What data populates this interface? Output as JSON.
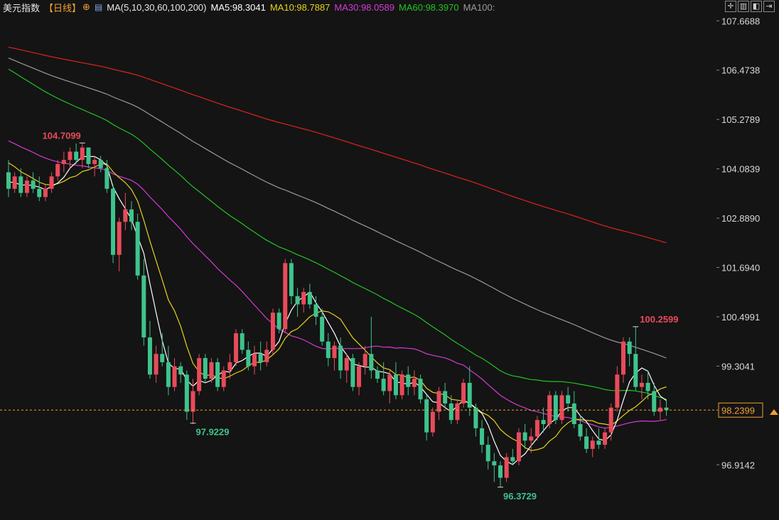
{
  "header": {
    "title": "美元指数",
    "period": "【日线】",
    "indicator": "MA(5,10,30,60,100,200)",
    "ma5": "MA5:98.3041",
    "ma10": "MA10:98.7887",
    "ma30": "MA30:98.0589",
    "ma60": "MA60:98.3970",
    "ma100": "MA100:"
  },
  "colors": {
    "up": "#e84b5a",
    "down": "#3fc38c",
    "ma5": "#ffffff",
    "ma10": "#e8d21a",
    "ma30": "#d63ad6",
    "ma60": "#22c322",
    "ma100": "#9a9a9a",
    "ma200": "#e02020",
    "price_line": "#f0a030"
  },
  "chart_data": {
    "type": "candlestick",
    "ylim": [
      96.3,
      107.76
    ],
    "yticks": [
      "107.6688",
      "106.4738",
      "105.2789",
      "104.0839",
      "102.8890",
      "101.6940",
      "100.4991",
      "99.3041",
      "96.9142"
    ],
    "current_price": "98.2399",
    "annotations": [
      {
        "label": "104.7099",
        "value": 104.7099,
        "color": "#e84b5a",
        "index": 12
      },
      {
        "label": "97.9229",
        "value": 97.9229,
        "color": "#3fc38c",
        "index": 30
      },
      {
        "label": "96.3729",
        "value": 96.3729,
        "color": "#3fc38c",
        "index": 80
      },
      {
        "label": "100.2599",
        "value": 100.2599,
        "color": "#e84b5a",
        "index": 102
      }
    ],
    "ohlc": [
      [
        104.0,
        104.3,
        103.4,
        103.6
      ],
      [
        103.6,
        104.0,
        103.5,
        103.9
      ],
      [
        103.9,
        104.1,
        103.4,
        103.5
      ],
      [
        103.5,
        103.9,
        103.4,
        103.8
      ],
      [
        103.8,
        104.0,
        103.5,
        103.6
      ],
      [
        103.6,
        103.9,
        103.3,
        103.4
      ],
      [
        103.4,
        103.7,
        103.3,
        103.6
      ],
      [
        103.6,
        104.0,
        103.5,
        103.9
      ],
      [
        103.9,
        104.3,
        103.8,
        104.2
      ],
      [
        104.2,
        104.5,
        104.0,
        104.3
      ],
      [
        104.3,
        104.6,
        104.1,
        104.5
      ],
      [
        104.5,
        104.7,
        104.2,
        104.3
      ],
      [
        104.3,
        104.7,
        104.1,
        104.6
      ],
      [
        104.6,
        104.6,
        104.1,
        104.2
      ],
      [
        104.2,
        104.4,
        103.9,
        104.3
      ],
      [
        104.3,
        104.4,
        104.0,
        104.1
      ],
      [
        104.1,
        104.3,
        103.5,
        103.6
      ],
      [
        103.6,
        103.7,
        101.8,
        102.0
      ],
      [
        102.0,
        102.9,
        101.6,
        102.8
      ],
      [
        102.8,
        103.5,
        102.6,
        103.1
      ],
      [
        103.1,
        103.3,
        102.6,
        102.8
      ],
      [
        102.8,
        103.0,
        101.4,
        101.5
      ],
      [
        101.5,
        101.9,
        99.8,
        100.0
      ],
      [
        100.0,
        100.4,
        99.0,
        99.1
      ],
      [
        99.1,
        99.8,
        98.9,
        99.6
      ],
      [
        99.6,
        100.1,
        99.3,
        99.4
      ],
      [
        99.4,
        99.8,
        98.6,
        98.8
      ],
      [
        98.8,
        99.5,
        98.7,
        99.3
      ],
      [
        99.3,
        99.4,
        98.9,
        99.1
      ],
      [
        99.1,
        99.2,
        98.0,
        98.2
      ],
      [
        98.2,
        99.0,
        97.9,
        98.7
      ],
      [
        98.7,
        99.6,
        98.6,
        99.5
      ],
      [
        99.5,
        99.6,
        98.9,
        99.0
      ],
      [
        99.0,
        99.5,
        98.9,
        99.4
      ],
      [
        99.4,
        99.5,
        98.7,
        98.8
      ],
      [
        98.8,
        99.3,
        98.7,
        99.2
      ],
      [
        99.2,
        99.6,
        99.0,
        99.4
      ],
      [
        99.4,
        100.2,
        99.3,
        100.1
      ],
      [
        100.1,
        100.2,
        99.6,
        99.7
      ],
      [
        99.7,
        99.9,
        99.2,
        99.3
      ],
      [
        99.3,
        99.8,
        99.1,
        99.6
      ],
      [
        99.6,
        99.9,
        99.2,
        99.4
      ],
      [
        99.4,
        99.9,
        99.3,
        99.7
      ],
      [
        99.7,
        100.7,
        99.6,
        100.6
      ],
      [
        100.6,
        100.7,
        100.1,
        100.2
      ],
      [
        100.2,
        101.9,
        100.1,
        101.8
      ],
      [
        101.8,
        101.9,
        100.8,
        101.0
      ],
      [
        101.0,
        101.2,
        100.5,
        100.8
      ],
      [
        100.8,
        101.2,
        100.6,
        101.1
      ],
      [
        101.1,
        101.3,
        100.7,
        100.8
      ],
      [
        100.8,
        101.0,
        100.3,
        100.5
      ],
      [
        100.5,
        100.7,
        99.8,
        99.9
      ],
      [
        99.9,
        100.1,
        99.3,
        99.5
      ],
      [
        99.5,
        99.9,
        99.2,
        99.8
      ],
      [
        99.8,
        100.0,
        99.0,
        99.2
      ],
      [
        99.2,
        99.6,
        98.9,
        99.5
      ],
      [
        99.5,
        99.6,
        98.7,
        98.8
      ],
      [
        98.8,
        99.4,
        98.6,
        99.3
      ],
      [
        99.3,
        99.8,
        99.1,
        99.6
      ],
      [
        99.6,
        100.5,
        99.0,
        99.2
      ],
      [
        99.2,
        99.3,
        98.9,
        99.0
      ],
      [
        99.0,
        99.4,
        98.6,
        98.7
      ],
      [
        98.7,
        99.2,
        98.4,
        99.1
      ],
      [
        99.1,
        99.4,
        98.5,
        98.6
      ],
      [
        98.6,
        99.2,
        98.5,
        99.1
      ],
      [
        99.1,
        99.3,
        98.6,
        98.8
      ],
      [
        98.8,
        99.2,
        98.6,
        99.0
      ],
      [
        99.0,
        99.1,
        98.4,
        98.5
      ],
      [
        98.5,
        98.6,
        97.5,
        97.7
      ],
      [
        97.7,
        98.3,
        97.6,
        98.2
      ],
      [
        98.2,
        98.8,
        98.0,
        98.7
      ],
      [
        98.7,
        98.9,
        98.3,
        98.4
      ],
      [
        98.4,
        98.6,
        97.9,
        98.0
      ],
      [
        98.0,
        98.5,
        97.9,
        98.4
      ],
      [
        98.4,
        99.0,
        98.3,
        98.9
      ],
      [
        98.9,
        99.3,
        98.1,
        98.3
      ],
      [
        98.3,
        98.4,
        97.6,
        97.8
      ],
      [
        97.8,
        98.0,
        97.2,
        97.4
      ],
      [
        97.4,
        97.6,
        96.8,
        97.0
      ],
      [
        97.0,
        97.2,
        96.5,
        96.9
      ],
      [
        96.9,
        97.0,
        96.37,
        96.6
      ],
      [
        96.6,
        97.2,
        96.5,
        97.1
      ],
      [
        97.1,
        97.3,
        96.9,
        97.0
      ],
      [
        97.0,
        97.8,
        96.9,
        97.7
      ],
      [
        97.7,
        97.9,
        97.3,
        97.5
      ],
      [
        97.5,
        97.8,
        97.2,
        97.6
      ],
      [
        97.6,
        98.1,
        97.5,
        98.0
      ],
      [
        98.0,
        98.3,
        97.7,
        97.9
      ],
      [
        97.9,
        98.7,
        97.8,
        98.6
      ],
      [
        98.6,
        98.7,
        97.9,
        98.0
      ],
      [
        98.0,
        98.7,
        97.9,
        98.6
      ],
      [
        98.6,
        98.8,
        98.2,
        98.4
      ],
      [
        98.4,
        98.7,
        97.8,
        97.9
      ],
      [
        97.9,
        98.1,
        97.5,
        97.6
      ],
      [
        97.6,
        97.8,
        97.2,
        97.3
      ],
      [
        97.3,
        97.6,
        97.1,
        97.5
      ],
      [
        97.5,
        97.8,
        97.3,
        97.4
      ],
      [
        97.4,
        97.8,
        97.3,
        97.7
      ],
      [
        97.7,
        98.4,
        97.5,
        98.3
      ],
      [
        98.3,
        99.3,
        98.2,
        99.1
      ],
      [
        99.1,
        100.0,
        98.9,
        99.9
      ],
      [
        99.9,
        100.0,
        99.3,
        99.6
      ],
      [
        99.6,
        100.26,
        98.7,
        98.8
      ],
      [
        98.8,
        99.1,
        98.5,
        98.9
      ],
      [
        98.9,
        99.2,
        98.5,
        98.7
      ],
      [
        98.7,
        98.9,
        98.1,
        98.2
      ],
      [
        98.2,
        98.5,
        98.0,
        98.3
      ],
      [
        98.3,
        98.5,
        98.1,
        98.24
      ]
    ]
  }
}
